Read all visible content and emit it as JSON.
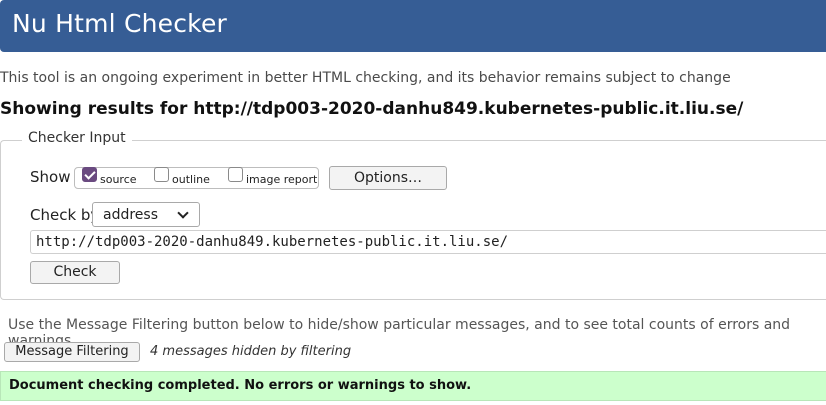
{
  "header": {
    "title": "Nu Html Checker"
  },
  "tagline": "This tool is an ongoing experiment in better HTML checking, and its behavior remains subject to change",
  "results_heading": "Showing results for http://tdp003-2020-danhu849.kubernetes-public.it.liu.se/",
  "checker_input": {
    "legend": "Checker Input",
    "show_label": "Show",
    "show_options": [
      {
        "label": "source",
        "checked": true
      },
      {
        "label": "outline",
        "checked": false
      },
      {
        "label": "image report",
        "checked": false
      }
    ],
    "options_button": "Options…",
    "check_by_label": "Check by",
    "check_by_value": "address",
    "url_value": "http://tdp003-2020-danhu849.kubernetes-public.it.liu.se/",
    "check_button": "Check"
  },
  "filtering": {
    "note": "Use the Message Filtering button below to hide/show particular messages, and to see total counts of errors and warnings.",
    "button": "Message Filtering",
    "hidden_note": "4 messages hidden by filtering"
  },
  "result": {
    "message": "Document checking completed. No errors or warnings to show."
  },
  "colors": {
    "header_bg": "#365d95",
    "success_bg": "#ccffcc",
    "checkbox_checked": "#6a4a80"
  }
}
